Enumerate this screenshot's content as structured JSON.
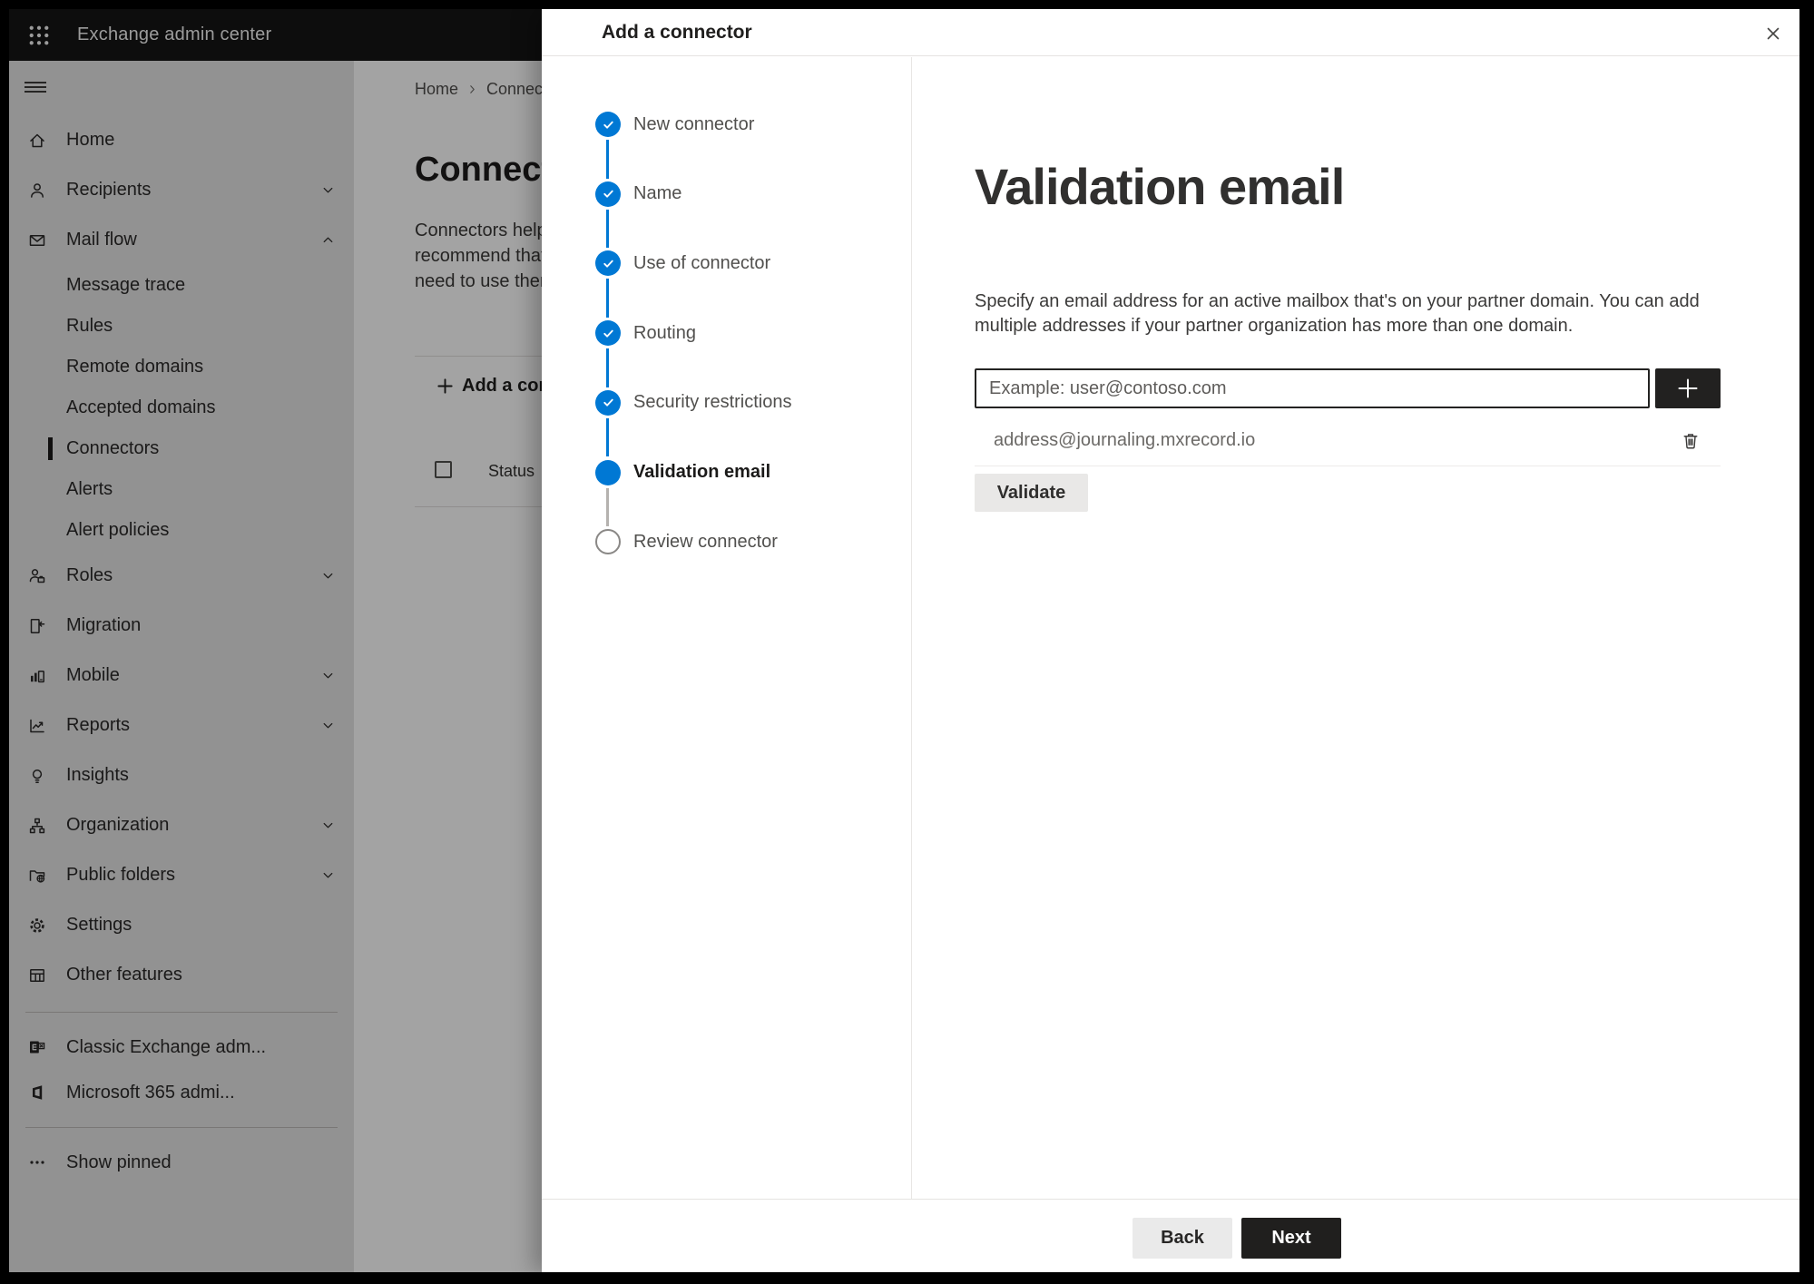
{
  "topbar": {
    "app_title": "Exchange admin center"
  },
  "sidebar": {
    "items": [
      {
        "label": "Home",
        "icon": "home-icon",
        "type": "top"
      },
      {
        "label": "Recipients",
        "icon": "person-icon",
        "type": "top",
        "chevron": "down"
      },
      {
        "label": "Mail flow",
        "icon": "mail-icon",
        "type": "top",
        "chevron": "up"
      },
      {
        "label": "Message trace",
        "type": "sub"
      },
      {
        "label": "Rules",
        "type": "sub"
      },
      {
        "label": "Remote domains",
        "type": "sub"
      },
      {
        "label": "Accepted domains",
        "type": "sub"
      },
      {
        "label": "Connectors",
        "type": "sub",
        "selected": true
      },
      {
        "label": "Alerts",
        "type": "sub"
      },
      {
        "label": "Alert policies",
        "type": "sub"
      },
      {
        "label": "Roles",
        "icon": "roles-icon",
        "type": "top",
        "chevron": "down"
      },
      {
        "label": "Migration",
        "icon": "migration-icon",
        "type": "top"
      },
      {
        "label": "Mobile",
        "icon": "mobile-icon",
        "type": "top",
        "chevron": "down"
      },
      {
        "label": "Reports",
        "icon": "reports-icon",
        "type": "top",
        "chevron": "down"
      },
      {
        "label": "Insights",
        "icon": "insights-icon",
        "type": "top"
      },
      {
        "label": "Organization",
        "icon": "organization-icon",
        "type": "top",
        "chevron": "down"
      },
      {
        "label": "Public folders",
        "icon": "public-folders-icon",
        "type": "top",
        "chevron": "down"
      },
      {
        "label": "Settings",
        "icon": "settings-icon",
        "type": "top"
      },
      {
        "label": "Other features",
        "icon": "other-features-icon",
        "type": "top"
      },
      {
        "divider": true
      },
      {
        "label": "Classic Exchange adm...",
        "icon": "classic-exchange-icon",
        "type": "bottom"
      },
      {
        "label": "Microsoft 365 admi...",
        "icon": "microsoft-365-icon",
        "type": "bottom"
      },
      {
        "divider": true
      },
      {
        "label": "Show pinned",
        "icon": "ellipsis-icon",
        "type": "bottom"
      }
    ]
  },
  "page": {
    "breadcrumb": [
      "Home",
      "Connectors"
    ],
    "title": "Connectors",
    "description_lines": [
      "Connectors help",
      "recommend that",
      "need to use them"
    ],
    "add_button_label": "Add a connector",
    "table": {
      "columns": [
        "Status"
      ]
    }
  },
  "dialog": {
    "title": "Add a connector",
    "steps": [
      {
        "label": "New connector",
        "state": "done"
      },
      {
        "label": "Name",
        "state": "done"
      },
      {
        "label": "Use of connector",
        "state": "done"
      },
      {
        "label": "Routing",
        "state": "done"
      },
      {
        "label": "Security restrictions",
        "state": "done"
      },
      {
        "label": "Validation email",
        "state": "active"
      },
      {
        "label": "Review connector",
        "state": "upcoming"
      }
    ],
    "content": {
      "heading": "Validation email",
      "description": "Specify an email address for an active mailbox that's on your partner domain. You can add multiple addresses if your partner organization has more than one domain.",
      "email_input": {
        "value": "",
        "placeholder": "Example: user@contoso.com"
      },
      "added_addresses": [
        "address@journaling.mxrecord.io"
      ],
      "validate_button_label": "Validate"
    },
    "footer": {
      "back_label": "Back",
      "next_label": "Next"
    }
  },
  "colors": {
    "accent_blue": "#0078d4",
    "dark_button": "#222120",
    "topbar_background": "#151515",
    "overlay": "rgba(0,0,0,0.36)"
  }
}
